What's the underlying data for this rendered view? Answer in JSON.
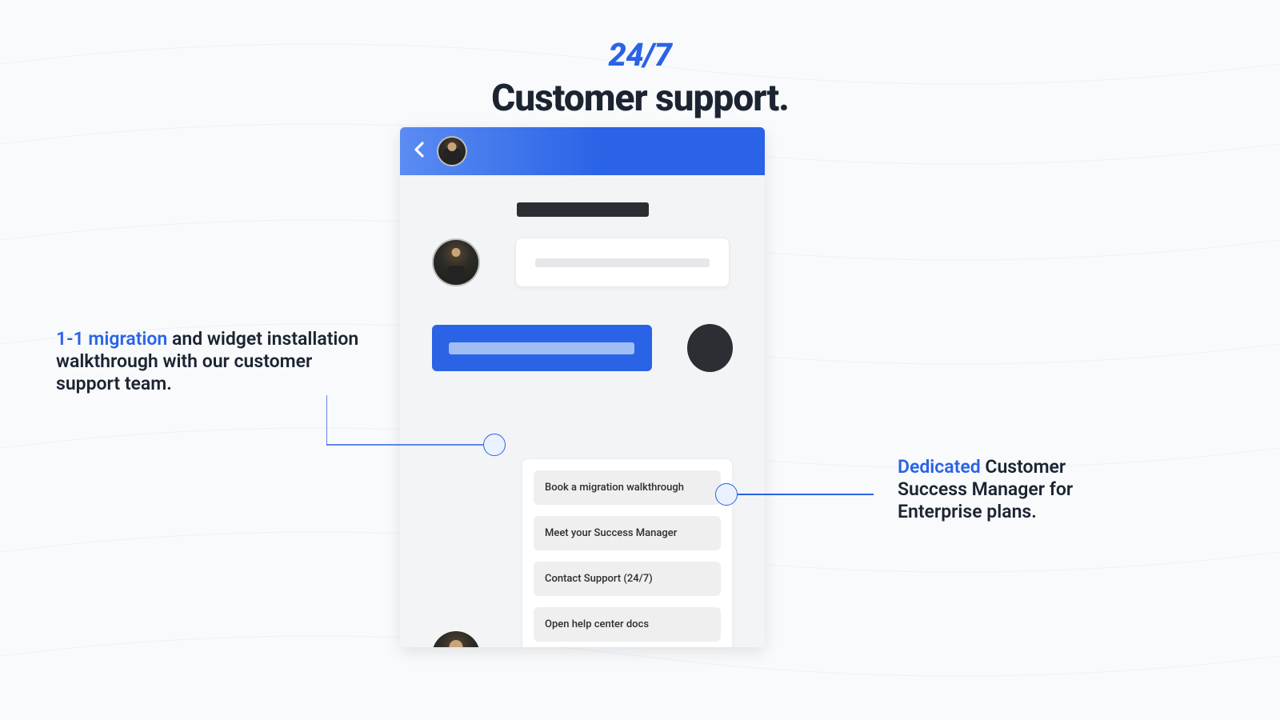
{
  "heading": {
    "kicker": "24/7",
    "title": "Customer support."
  },
  "chat": {
    "actions": [
      {
        "label": "Book a migration walkthrough"
      },
      {
        "label": "Meet your Success Manager"
      },
      {
        "label": "Contact Support (24/7)"
      },
      {
        "label": "Open help center docs"
      }
    ]
  },
  "callouts": {
    "left": {
      "highlight": "1-1 migration",
      "rest": " and widget installation walkthrough with our customer support team."
    },
    "right": {
      "highlight": "Dedicated",
      "rest": " Customer Success Manager for Enterprise plans."
    }
  },
  "colors": {
    "accent": "#2a63e6",
    "dark": "#1c2431"
  }
}
